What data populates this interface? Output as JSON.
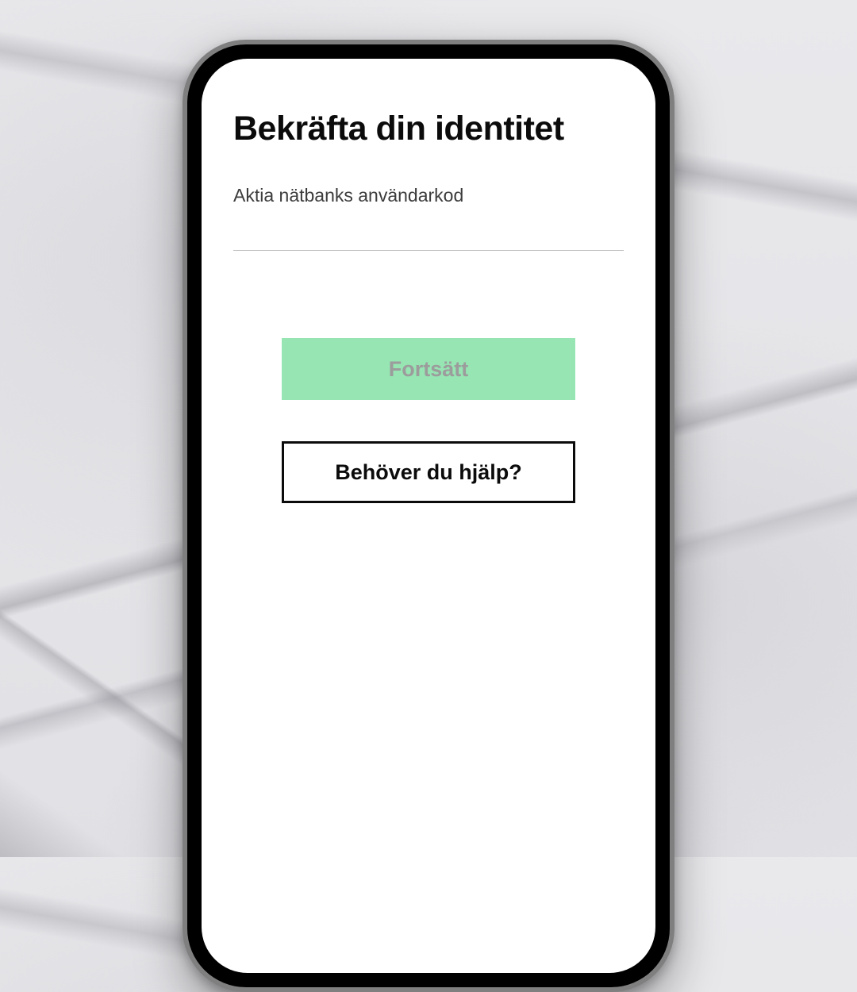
{
  "colors": {
    "accent": "#96e5b3"
  },
  "screen": {
    "title": "Bekräfta din identitet",
    "field": {
      "label": "Aktia nätbanks användarkod",
      "value": ""
    },
    "primary_button": {
      "label": "Fortsätt"
    },
    "secondary_button": {
      "label": "Behöver du hjälp?"
    }
  }
}
